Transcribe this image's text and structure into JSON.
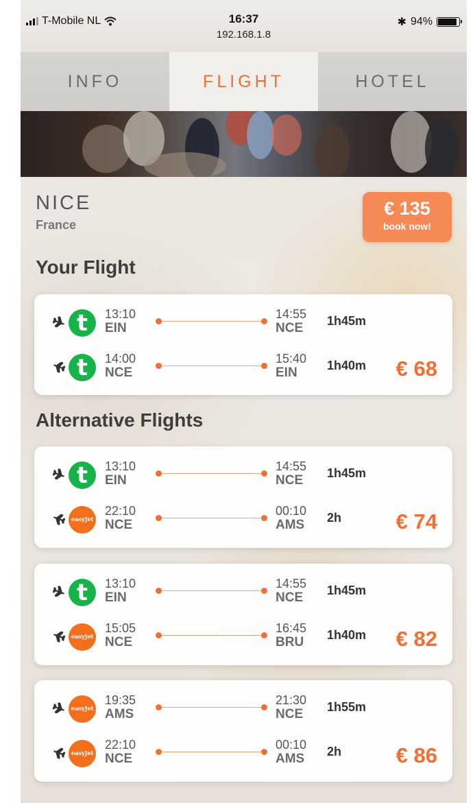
{
  "status_bar": {
    "carrier": "T-Mobile NL",
    "time": "16:37",
    "url": "192.168.1.8",
    "bluetooth": "✱",
    "battery": "94%",
    "battery_level": 0.94
  },
  "tabs": [
    {
      "label": "INFO",
      "active": false
    },
    {
      "label": "FLIGHT",
      "active": true
    },
    {
      "label": "HOTEL",
      "active": false
    }
  ],
  "destination": {
    "city": "NICE",
    "country": "France"
  },
  "book": {
    "price": "€ 135",
    "cta": "book now!"
  },
  "sections": {
    "your_flight": "Your Flight",
    "alternative_flights": "Alternative Flights"
  },
  "airlines": {
    "transavia": {
      "glyph": "t",
      "color": "#17b34a"
    },
    "easyjet": {
      "glyph": "easyJet",
      "color": "#f26f1e"
    }
  },
  "your_flight": {
    "price": "€ 68",
    "legs": [
      {
        "airline": "transavia",
        "dep_time": "13:10",
        "dep_code": "EIN",
        "arr_time": "14:55",
        "arr_code": "NCE",
        "duration": "1h45m"
      },
      {
        "airline": "transavia",
        "dep_time": "14:00",
        "dep_code": "NCE",
        "arr_time": "15:40",
        "arr_code": "EIN",
        "duration": "1h40m"
      }
    ]
  },
  "alternatives": [
    {
      "price": "€ 74",
      "legs": [
        {
          "airline": "transavia",
          "dep_time": "13:10",
          "dep_code": "EIN",
          "arr_time": "14:55",
          "arr_code": "NCE",
          "duration": "1h45m"
        },
        {
          "airline": "easyjet",
          "dep_time": "22:10",
          "dep_code": "NCE",
          "arr_time": "00:10",
          "arr_code": "AMS",
          "duration": "2h"
        }
      ]
    },
    {
      "price": "€ 82",
      "legs": [
        {
          "airline": "transavia",
          "dep_time": "13:10",
          "dep_code": "EIN",
          "arr_time": "14:55",
          "arr_code": "NCE",
          "duration": "1h45m"
        },
        {
          "airline": "easyjet",
          "dep_time": "15:05",
          "dep_code": "NCE",
          "arr_time": "16:45",
          "arr_code": "BRU",
          "duration": "1h40m"
        }
      ]
    },
    {
      "price": "€ 86",
      "legs": [
        {
          "airline": "easyjet",
          "dep_time": "19:35",
          "dep_code": "AMS",
          "arr_time": "21:30",
          "arr_code": "NCE",
          "duration": "1h55m"
        },
        {
          "airline": "easyjet",
          "dep_time": "22:10",
          "dep_code": "NCE",
          "arr_time": "00:10",
          "arr_code": "AMS",
          "duration": "2h"
        }
      ]
    }
  ],
  "colors": {
    "accent": "#f26f33",
    "book_button": "#f58a57"
  }
}
